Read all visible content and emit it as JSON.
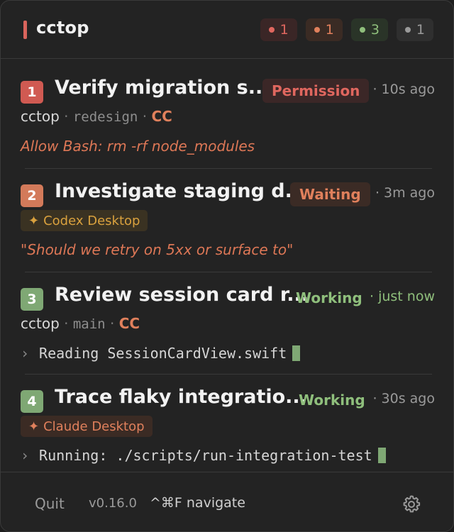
{
  "header": {
    "title": "cctop",
    "counters": [
      {
        "color": "red",
        "count": "1"
      },
      {
        "color": "orange",
        "count": "1"
      },
      {
        "color": "green",
        "count": "3"
      },
      {
        "color": "gray",
        "count": "1"
      }
    ]
  },
  "sessions": [
    {
      "number": "1",
      "title": "Verify migration s...",
      "status": "Permission",
      "time": "· 10s ago",
      "project": "cctop",
      "branch": "redesign",
      "client": "CC",
      "detail": "Allow Bash: rm -rf node_modules"
    },
    {
      "number": "2",
      "title": "Investigate staging d...",
      "status": "Waiting",
      "time": "· 3m ago",
      "tag": "Codex Desktop",
      "detail": "\"Should we retry on 5xx or surface to\""
    },
    {
      "number": "3",
      "title": "Review session card r...",
      "status": "Working",
      "time": "· just now",
      "project": "cctop",
      "branch": "main",
      "client": "CC",
      "detail": "Reading SessionCardView.swift"
    },
    {
      "number": "4",
      "title": "Trace flaky integratio...",
      "status": "Working",
      "time": "· 30s ago",
      "tag": "Claude Desktop",
      "detail": "Running: ./scripts/run-integration-test"
    }
  ],
  "footer": {
    "quit_label": "Quit",
    "version": "v0.16.0",
    "shortcut": "^⌘F navigate"
  },
  "colors": {
    "red": "#e0675f",
    "orange": "#e0805c",
    "green": "#8fbf7c",
    "gray": "#9a9a9a",
    "codex": "#d9a13e"
  },
  "icons": {
    "tag_glyph": "✦",
    "detail_prompt": "›",
    "settings": "gear-icon"
  }
}
